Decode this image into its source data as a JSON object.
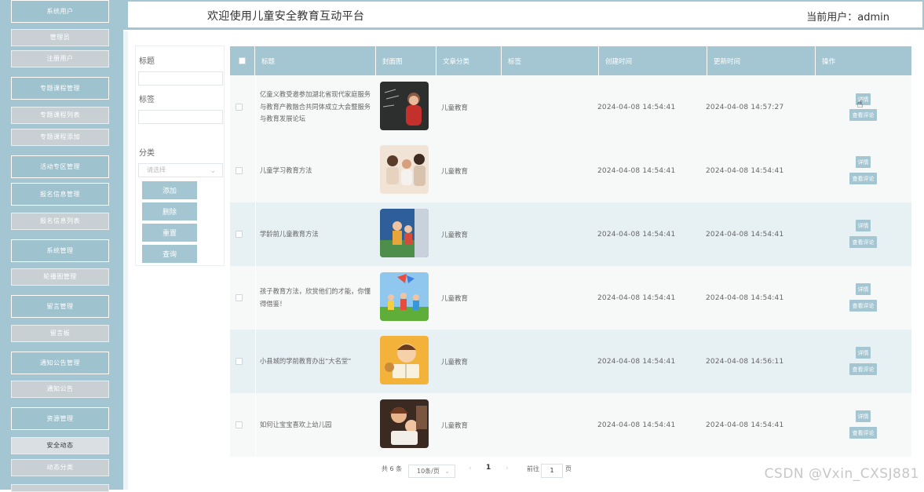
{
  "sidebar": {
    "items": [
      {
        "label": "系统用户",
        "kind": "group"
      },
      {
        "label": "管理员",
        "kind": "sub"
      },
      {
        "label": "注册用户",
        "kind": "sub"
      },
      {
        "label": "专题课程管理",
        "kind": "group"
      },
      {
        "label": "专题课程列表",
        "kind": "sub"
      },
      {
        "label": "专题课程添加",
        "kind": "sub"
      },
      {
        "label": "活动专区管理",
        "kind": "group"
      },
      {
        "label": "报名信息管理",
        "kind": "group"
      },
      {
        "label": "报名信息列表",
        "kind": "sub"
      },
      {
        "label": "系统管理",
        "kind": "group"
      },
      {
        "label": "轮播图管理",
        "kind": "sub"
      },
      {
        "label": "留言管理",
        "kind": "group"
      },
      {
        "label": "留言板",
        "kind": "sub"
      },
      {
        "label": "通知公告管理",
        "kind": "group"
      },
      {
        "label": "通知公告",
        "kind": "sub"
      },
      {
        "label": "资源管理",
        "kind": "group"
      },
      {
        "label": "安全动态",
        "kind": "sub",
        "active": true
      },
      {
        "label": "动态分类",
        "kind": "sub"
      }
    ]
  },
  "header": {
    "title": "欢迎使用儿童安全教育互动平台",
    "user": "当前用户：admin"
  },
  "filter": {
    "title_label": "标题",
    "tag_label": "标签",
    "category_label": "分类",
    "category_placeholder": "请选择",
    "buttons": {
      "add": "添加",
      "delete": "删除",
      "reset": "重置",
      "query": "查询"
    }
  },
  "table": {
    "headers": {
      "title": "标题",
      "cover": "封面图",
      "category": "文章分类",
      "tag": "标签",
      "created": "创建时间",
      "updated": "更新时间",
      "actions": "操作"
    },
    "rows": [
      {
        "title": "亿童义教受邀参加湖北省现代家庭服务与教育产教融合共同体成立大会暨服务与教育发展论坛",
        "category": "儿童教育",
        "created": "2024-04-08 14:54:41",
        "updated": "2024-04-08 14:57:27",
        "cover_theme": "chalkboard"
      },
      {
        "title": "儿童学习教育方法",
        "category": "儿童教育",
        "created": "2024-04-08 14:54:41",
        "updated": "2024-04-08 14:54:41",
        "cover_theme": "family"
      },
      {
        "title": "学龄前儿童教育方法",
        "category": "儿童教育",
        "created": "2024-04-08 14:54:41",
        "updated": "2024-04-08 14:54:41",
        "cover_theme": "cartoon"
      },
      {
        "title": "孩子教育方法，欣赏他们的才能，你懂得借鉴！",
        "category": "儿童教育",
        "created": "2024-04-08 14:54:41",
        "updated": "2024-04-08 14:54:41",
        "cover_theme": "kite"
      },
      {
        "title": "小县城的学前教育办出“大名堂”",
        "category": "儿童教育",
        "created": "2024-04-08 14:54:41",
        "updated": "2024-04-08 14:56:11",
        "cover_theme": "reading"
      },
      {
        "title": "如何让宝宝喜欢上幼儿园",
        "category": "儿童教育",
        "created": "2024-04-08 14:54:41",
        "updated": "2024-04-08 14:54:41",
        "cover_theme": "mother"
      }
    ],
    "action_detail": "详情",
    "action_comment": "查看评论"
  },
  "pagination": {
    "total": "共 6 条",
    "page_size": "10条/页",
    "prev": "‹",
    "current": "1",
    "next": "›",
    "goto": "前往",
    "goto_value": "1",
    "page_suffix": "页"
  },
  "watermark": "CSDN @Vxin_CXSJ881",
  "colors": {
    "accent": "#a3c6d2",
    "row_alt": "#e7f0f3",
    "row": "#f7f8f8"
  }
}
